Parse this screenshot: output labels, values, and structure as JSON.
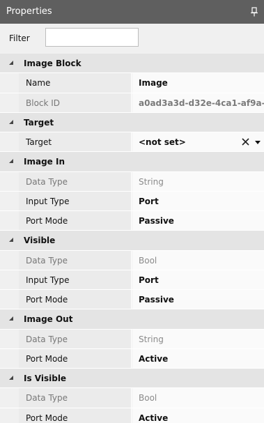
{
  "panel": {
    "title": "Properties",
    "pin_icon": "pin-icon"
  },
  "filter": {
    "label": "Filter",
    "value": ""
  },
  "categories": [
    {
      "label": "Image Block",
      "rows": [
        {
          "name": "Name",
          "value": "Image",
          "name_style": "rw",
          "value_style": "bold"
        },
        {
          "name": "Block ID",
          "value": "a0ad3a3d-d32e-4ca1-af9a-",
          "name_style": "ro",
          "value_style": "muted-bold"
        }
      ]
    },
    {
      "label": "Target",
      "rows": [
        {
          "name": "Target",
          "value": "<not set>",
          "name_style": "rw",
          "value_style": "bold",
          "has_clear": true
        }
      ]
    },
    {
      "label": "Image In",
      "rows": [
        {
          "name": "Data Type",
          "value": "String",
          "name_style": "ro",
          "value_style": "muted"
        },
        {
          "name": "Input Type",
          "value": "Port",
          "name_style": "rw",
          "value_style": "bold"
        },
        {
          "name": "Port Mode",
          "value": "Passive",
          "name_style": "rw",
          "value_style": "bold"
        }
      ]
    },
    {
      "label": "Visible",
      "rows": [
        {
          "name": "Data Type",
          "value": "Bool",
          "name_style": "ro",
          "value_style": "muted"
        },
        {
          "name": "Input Type",
          "value": "Port",
          "name_style": "rw",
          "value_style": "bold"
        },
        {
          "name": "Port Mode",
          "value": "Passive",
          "name_style": "rw",
          "value_style": "bold"
        }
      ]
    },
    {
      "label": "Image Out",
      "rows": [
        {
          "name": "Data Type",
          "value": "String",
          "name_style": "ro",
          "value_style": "muted"
        },
        {
          "name": "Port Mode",
          "value": "Active",
          "name_style": "rw",
          "value_style": "bold"
        }
      ]
    },
    {
      "label": "Is Visible",
      "rows": [
        {
          "name": "Data Type",
          "value": "Bool",
          "name_style": "ro",
          "value_style": "muted"
        },
        {
          "name": "Port Mode",
          "value": "Active",
          "name_style": "rw",
          "value_style": "bold"
        }
      ]
    }
  ],
  "icons": {
    "collapse": "collapse-triangle-icon",
    "clear": "close-icon",
    "dropdown": "chevron-down-icon"
  },
  "colors": {
    "titlebar": "#5f5f5f",
    "category_bg": "#e4e4e4",
    "name_bg": "#ebebeb",
    "value_bg": "#fafafa"
  }
}
